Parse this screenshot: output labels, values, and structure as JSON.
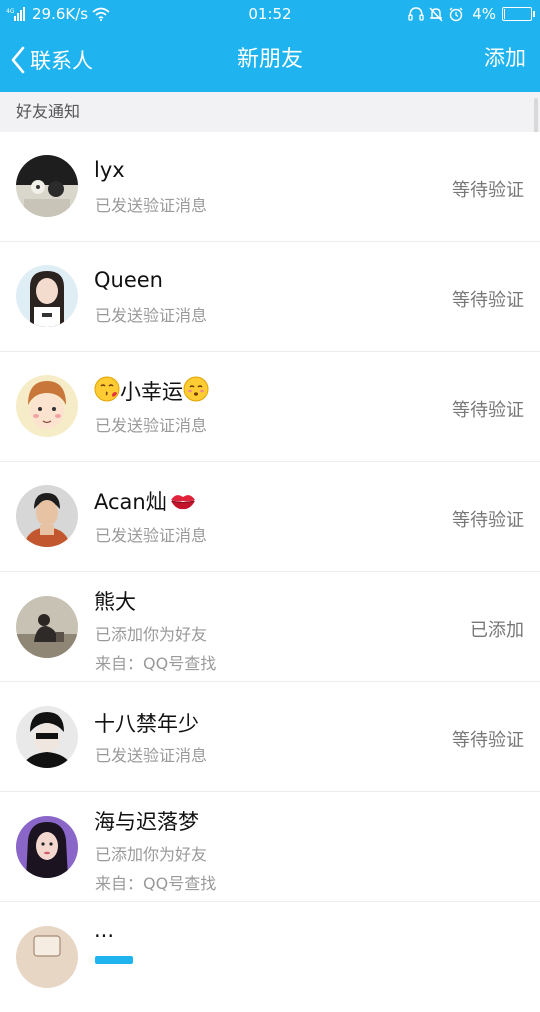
{
  "status_bar": {
    "network_type": "4G",
    "speed": "29.6K/s",
    "time": "01:52",
    "battery": "4%",
    "battery_level": 0.04
  },
  "nav": {
    "back_label": "联系人",
    "title": "新朋友",
    "add_label": "添加"
  },
  "section": {
    "title": "好友通知"
  },
  "requests": [
    {
      "name": "lyx",
      "message": "已发送验证消息",
      "source": "",
      "status": "等待验证"
    },
    {
      "name": "Queen",
      "message": "已发送验证消息",
      "source": "",
      "status": "等待验证"
    },
    {
      "name": "小幸运",
      "message": "已发送验证消息",
      "source": "",
      "status": "等待验证"
    },
    {
      "name": "Acan灿",
      "message": "已发送验证消息",
      "source": "",
      "status": "等待验证"
    },
    {
      "name": "熊大",
      "message": "已添加你为好友",
      "source": "来自：QQ号查找",
      "status": "已添加"
    },
    {
      "name": "十八禁年少",
      "message": "已发送验证消息",
      "source": "",
      "status": "等待验证"
    },
    {
      "name": "海与迟落梦",
      "message": "已添加你为好友",
      "source": "来自：QQ号查找",
      "status": ""
    },
    {
      "name": "...",
      "message": "",
      "source": "",
      "status": ""
    }
  ],
  "colors": {
    "brand": "#1fb4ef",
    "section_bg": "#f2f2f4",
    "secondary_text": "#9a9a9a"
  },
  "icons": {
    "back": "chevron-left-icon",
    "kiss_emoji": "kissing-face-emoji-icon",
    "lips_emoji": "kiss-mark-emoji-icon"
  }
}
